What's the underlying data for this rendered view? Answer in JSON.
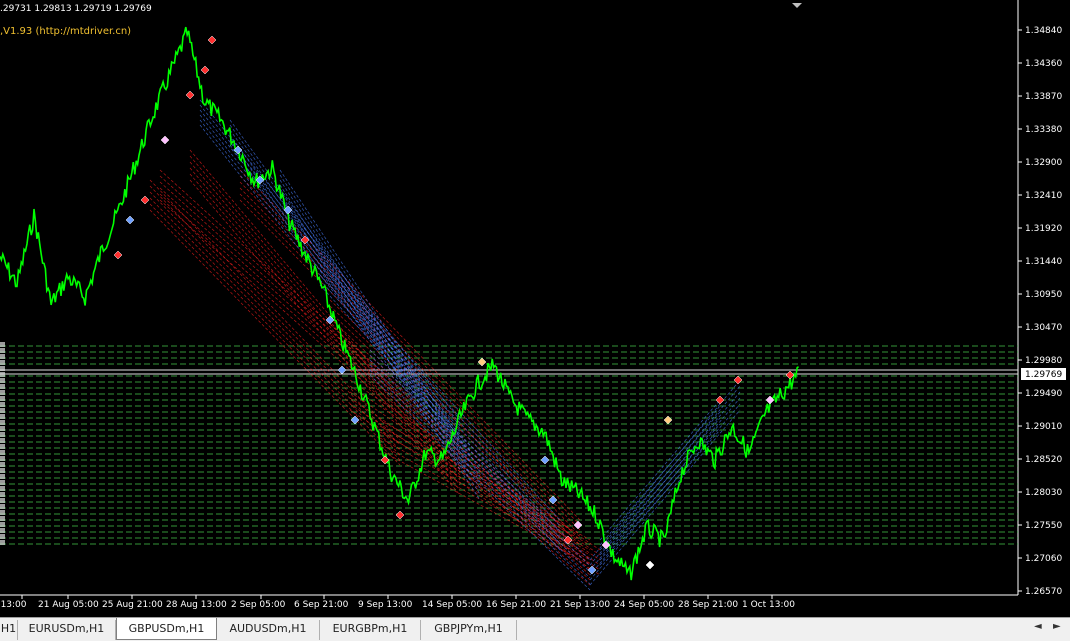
{
  "chart": {
    "ohlc_text": ".29731 1.29813 1.29719 1.29769",
    "indicator_text": ",V1.93 (http://mtdriver.cn)",
    "current_price": "1.29769",
    "price_labels": [
      "1.34840",
      "1.34360",
      "1.33870",
      "1.33380",
      "1.32900",
      "1.32410",
      "1.31920",
      "1.31440",
      "1.30950",
      "1.30470",
      "1.29980",
      "1.29490",
      "1.29010",
      "1.28520",
      "1.28030",
      "1.27550",
      "1.27060",
      "1.26570"
    ],
    "time_labels": [
      "g 13:00",
      "21 Aug 05:00",
      "25 Aug 21:00",
      "28 Aug 13:00",
      "2 Sep 05:00",
      "6 Sep 21:00",
      "9 Sep 13:00",
      "14 Sep 05:00",
      "16 Sep 21:00",
      "21 Sep 13:00",
      "24 Sep 05:00",
      "28 Sep 21:00",
      "1 Oct 13:00"
    ],
    "colors": {
      "background": "#000000",
      "price_line": "#00ff00",
      "level_lines": "#3cb043",
      "axis": "#ffffff",
      "buy_lines": "#ff2020",
      "sell_lines": "#4a7fff"
    }
  },
  "chart_data": {
    "type": "line",
    "series": [
      {
        "values": [
          1.315,
          1.311,
          1.321,
          1.308,
          1.312,
          1.309,
          1.316,
          1.322,
          1.329,
          1.336,
          1.342,
          1.348,
          1.338,
          1.335,
          1.331,
          1.326,
          1.328,
          1.32,
          1.315,
          1.31,
          1.303,
          1.297,
          1.29,
          1.283,
          1.279,
          1.286,
          1.285,
          1.291,
          1.296,
          1.299,
          1.294,
          1.291,
          1.289,
          1.282,
          1.28,
          1.277,
          1.271,
          1.268,
          1.275,
          1.273,
          1.283,
          1.288,
          1.285,
          1.29,
          1.286,
          1.292,
          1.295,
          1.298
        ]
      }
    ],
    "ylim": [
      1.2657,
      1.3484
    ]
  },
  "tabs": [
    {
      "label": "H1",
      "icon": "tab-icon"
    },
    {
      "label": "EURUSDm,H1"
    },
    {
      "label": "GBPUSDm,H1",
      "active": true
    },
    {
      "label": "AUDUSDm,H1"
    },
    {
      "label": "EURGBPm,H1"
    },
    {
      "label": "GBPJPYm,H1"
    }
  ],
  "scroll": {
    "left": "◄",
    "right": "►"
  }
}
